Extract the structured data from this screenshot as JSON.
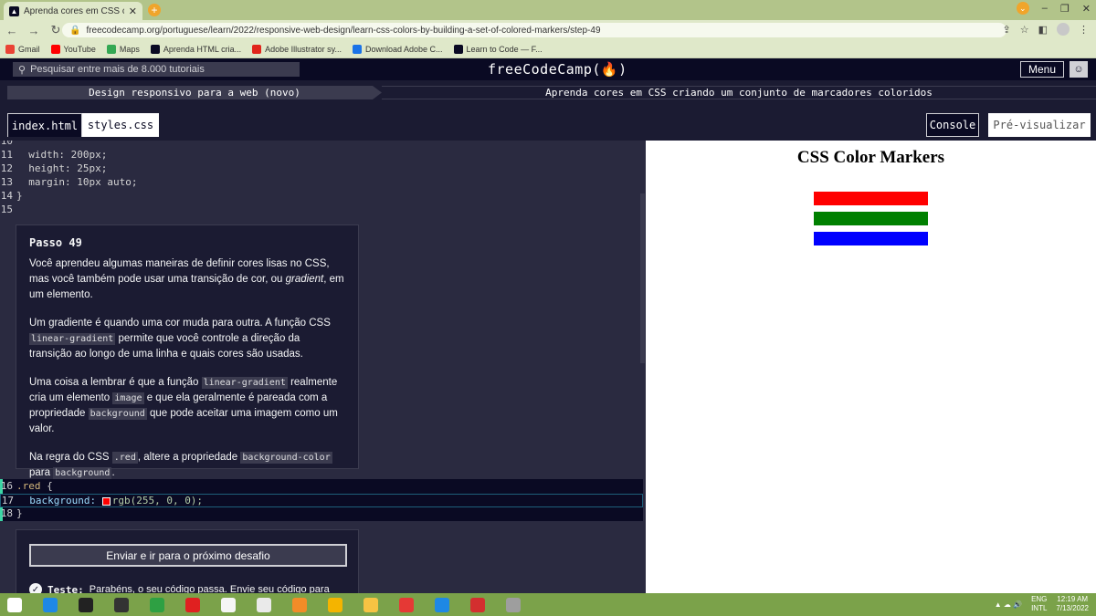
{
  "browser": {
    "tab_title": "Aprenda cores em CSS criando u",
    "url": "freecodecamp.org/portuguese/learn/2022/responsive-web-design/learn-css-colors-by-building-a-set-of-colored-markers/step-49",
    "bookmarks": [
      {
        "label": "Gmail",
        "color": "#ea4335"
      },
      {
        "label": "YouTube",
        "color": "#ff0000"
      },
      {
        "label": "Maps",
        "color": "#34a853"
      },
      {
        "label": "Aprenda HTML cria...",
        "color": "#0a0a23"
      },
      {
        "label": "Adobe Illustrator sy...",
        "color": "#e1251b"
      },
      {
        "label": "Download Adobe C...",
        "color": "#1a73e8"
      },
      {
        "label": "Learn to Code — F...",
        "color": "#0a0a23"
      }
    ]
  },
  "fcc_nav": {
    "search_placeholder": "Pesquisar entre mais de 8.000 tutoriais",
    "logo": "freeCodeCamp(🔥)",
    "menu_label": "Menu"
  },
  "breadcrumb": {
    "course": "Design responsivo para a web (novo)",
    "project": "Aprenda cores em CSS criando um conjunto de marcadores coloridos"
  },
  "tabs": {
    "index": "index.html",
    "styles": "styles.css",
    "console": "Console",
    "preview": "Pré-visualizar"
  },
  "code_top": [
    {
      "n": "11",
      "text": "  width: 200px;"
    },
    {
      "n": "12",
      "text": "  height: 25px;"
    },
    {
      "n": "13",
      "text": "  margin: 10px auto;"
    },
    {
      "n": "14",
      "text": "}"
    },
    {
      "n": "15",
      "text": ""
    }
  ],
  "step": {
    "title": "Passo 49",
    "p1a": "Você aprendeu algumas maneiras de definir cores lisas no CSS, mas você também pode usar uma transição de cor, ou ",
    "p1em": "gradient",
    "p1b": ", em um elemento.",
    "p2a": "Um gradiente é quando uma cor muda para outra. A função CSS ",
    "p2code": "linear-gradient",
    "p2b": " permite que você controle a direção da transição ao longo de uma linha e quais cores são usadas.",
    "p3a": "Uma coisa a lembrar é que a função ",
    "p3code1": "linear-gradient",
    "p3b": " realmente cria um elemento ",
    "p3code2": "image",
    "p3c": " e que ela geralmente é pareada com a propriedade ",
    "p3code3": "background",
    "p3d": " que pode aceitar uma imagem como um valor.",
    "p4a": "Na regra do CSS ",
    "p4code1": ".red",
    "p4b": ", altere a propriedade ",
    "p4code2": "background-color",
    "p4c": " para ",
    "p4code3": "background",
    "p4d": "."
  },
  "editable": {
    "l16_n": "16",
    "l16_sel": ".red",
    "l16_brace": " {",
    "l17_n": "17",
    "l17_prop": "  background: ",
    "l17_val": "rgb(255, 0, 0);",
    "l18_n": "18",
    "l18_text": "}"
  },
  "lower": {
    "submit": "Enviar e ir para o próximo desafio",
    "test_label": "Teste:",
    "test_text": "Parabéns, o seu código passa. Envie seu código para"
  },
  "preview": {
    "title": "CSS Color Markers",
    "markers": [
      {
        "name": "red",
        "color": "#ff0000"
      },
      {
        "name": "green",
        "color": "#008000"
      },
      {
        "name": "blue",
        "color": "#0000ff"
      }
    ]
  },
  "taskbar": {
    "lang1": "ENG",
    "lang2": "INTL",
    "time": "12:19 AM",
    "date": "7/13/2022"
  }
}
